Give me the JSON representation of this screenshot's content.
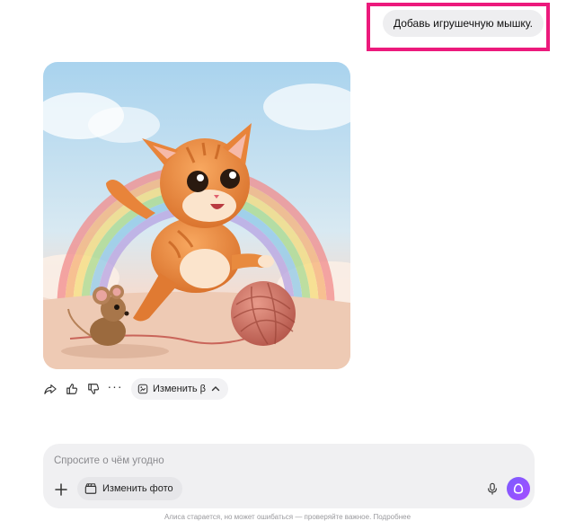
{
  "user_message": {
    "text": "Добавь игрушечную мышку."
  },
  "image": {
    "subject": "kitten-rainbow-mouse-yarn"
  },
  "actions": {
    "share_icon": "share-icon",
    "like_icon": "thumbs-up-icon",
    "dislike_icon": "thumbs-down-icon",
    "more_label": "···",
    "edit_label": "Изменить β"
  },
  "composer": {
    "placeholder": "Спросите о чём угодно",
    "edit_photo_label": "Изменить фото"
  },
  "footer": {
    "disclaimer": "Алиса старается, но может ошибаться — проверяйте важное. Подробнее"
  },
  "colors": {
    "highlight": "#ec1a7c",
    "accent": "#8a55ff",
    "bubble": "#eeeef0",
    "composer": "#f0f0f2"
  }
}
